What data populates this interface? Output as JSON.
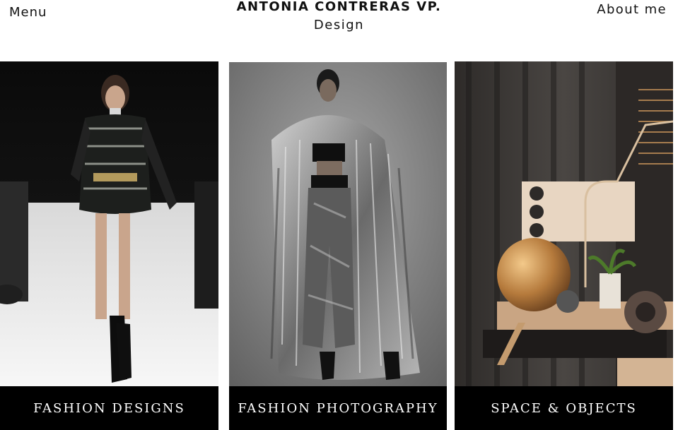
{
  "header": {
    "menu_label": "Menu",
    "brand_name": "ANTONIA CONTRERAS VP.",
    "brand_subtitle": "Design",
    "about_label": "About me"
  },
  "cards": [
    {
      "label": "FASHION DESIGNS",
      "image": "runway-model-photo"
    },
    {
      "label": "FASHION PHOTOGRAPHY",
      "image": "editorial-fur-coat-photo"
    },
    {
      "label": "SPACE & OBJECTS",
      "image": "3d-interior-objects-render"
    }
  ],
  "colors": {
    "background": "#ffffff",
    "label_bar": "#000000",
    "label_text": "#ffffff",
    "text": "#111111"
  }
}
